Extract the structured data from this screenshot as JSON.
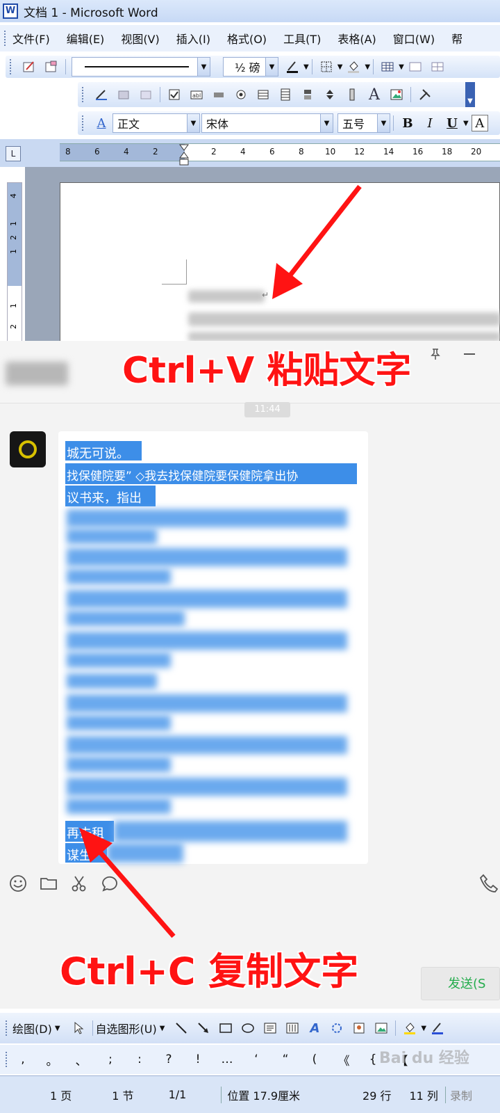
{
  "window": {
    "title": "文档 1 - Microsoft Word",
    "app_icon": "W"
  },
  "menu": {
    "items": [
      "文件(F)",
      "编辑(E)",
      "视图(V)",
      "插入(I)",
      "格式(O)",
      "工具(T)",
      "表格(A)",
      "窗口(W)",
      "帮"
    ]
  },
  "toolbar1": {
    "line_weight": "½ 磅"
  },
  "format": {
    "style": "正文",
    "font": "宋体",
    "size": "五号",
    "bold": "B",
    "italic": "I",
    "underline": "U",
    "fontcolor": "A"
  },
  "ruler": {
    "corner": "L",
    "ticks": [
      "8",
      "6",
      "4",
      "2",
      "2",
      "4",
      "6",
      "8",
      "10",
      "12",
      "14",
      "16",
      "18",
      "20"
    ],
    "vticks": [
      "4",
      "1",
      "2",
      "1",
      "1",
      "2"
    ]
  },
  "chat": {
    "time": "11:44",
    "lines": [
      "城无可说。",
      "找保健院要” ◇我去找保健院要保健院拿出协",
      "议书来，指出",
      "再去租",
      "谋生"
    ],
    "send_label": "发送(S"
  },
  "annotations": {
    "paste": "Ctrl+V 粘贴文字",
    "copy": "Ctrl+C 复制文字"
  },
  "drawing": {
    "draw_label": "绘图(D)",
    "autoshape_label": "自选图形(U)"
  },
  "symbols": [
    ",",
    "。",
    "、",
    ";",
    ":",
    "?",
    "!",
    "…",
    "‘",
    "“",
    "(",
    "《",
    "{",
    "【"
  ],
  "status": {
    "page": "1 页",
    "section": "1 节",
    "pages": "1/1",
    "position": "位置 17.9厘米",
    "line": "29 行",
    "col": "11 列",
    "rec": "录制"
  },
  "watermark": "Bai du 经验",
  "colors": {
    "annotation": "#ff1313",
    "selection": "#3d8ee8",
    "send": "#24ac4c",
    "word_toolbar": "#d5e3f8"
  }
}
